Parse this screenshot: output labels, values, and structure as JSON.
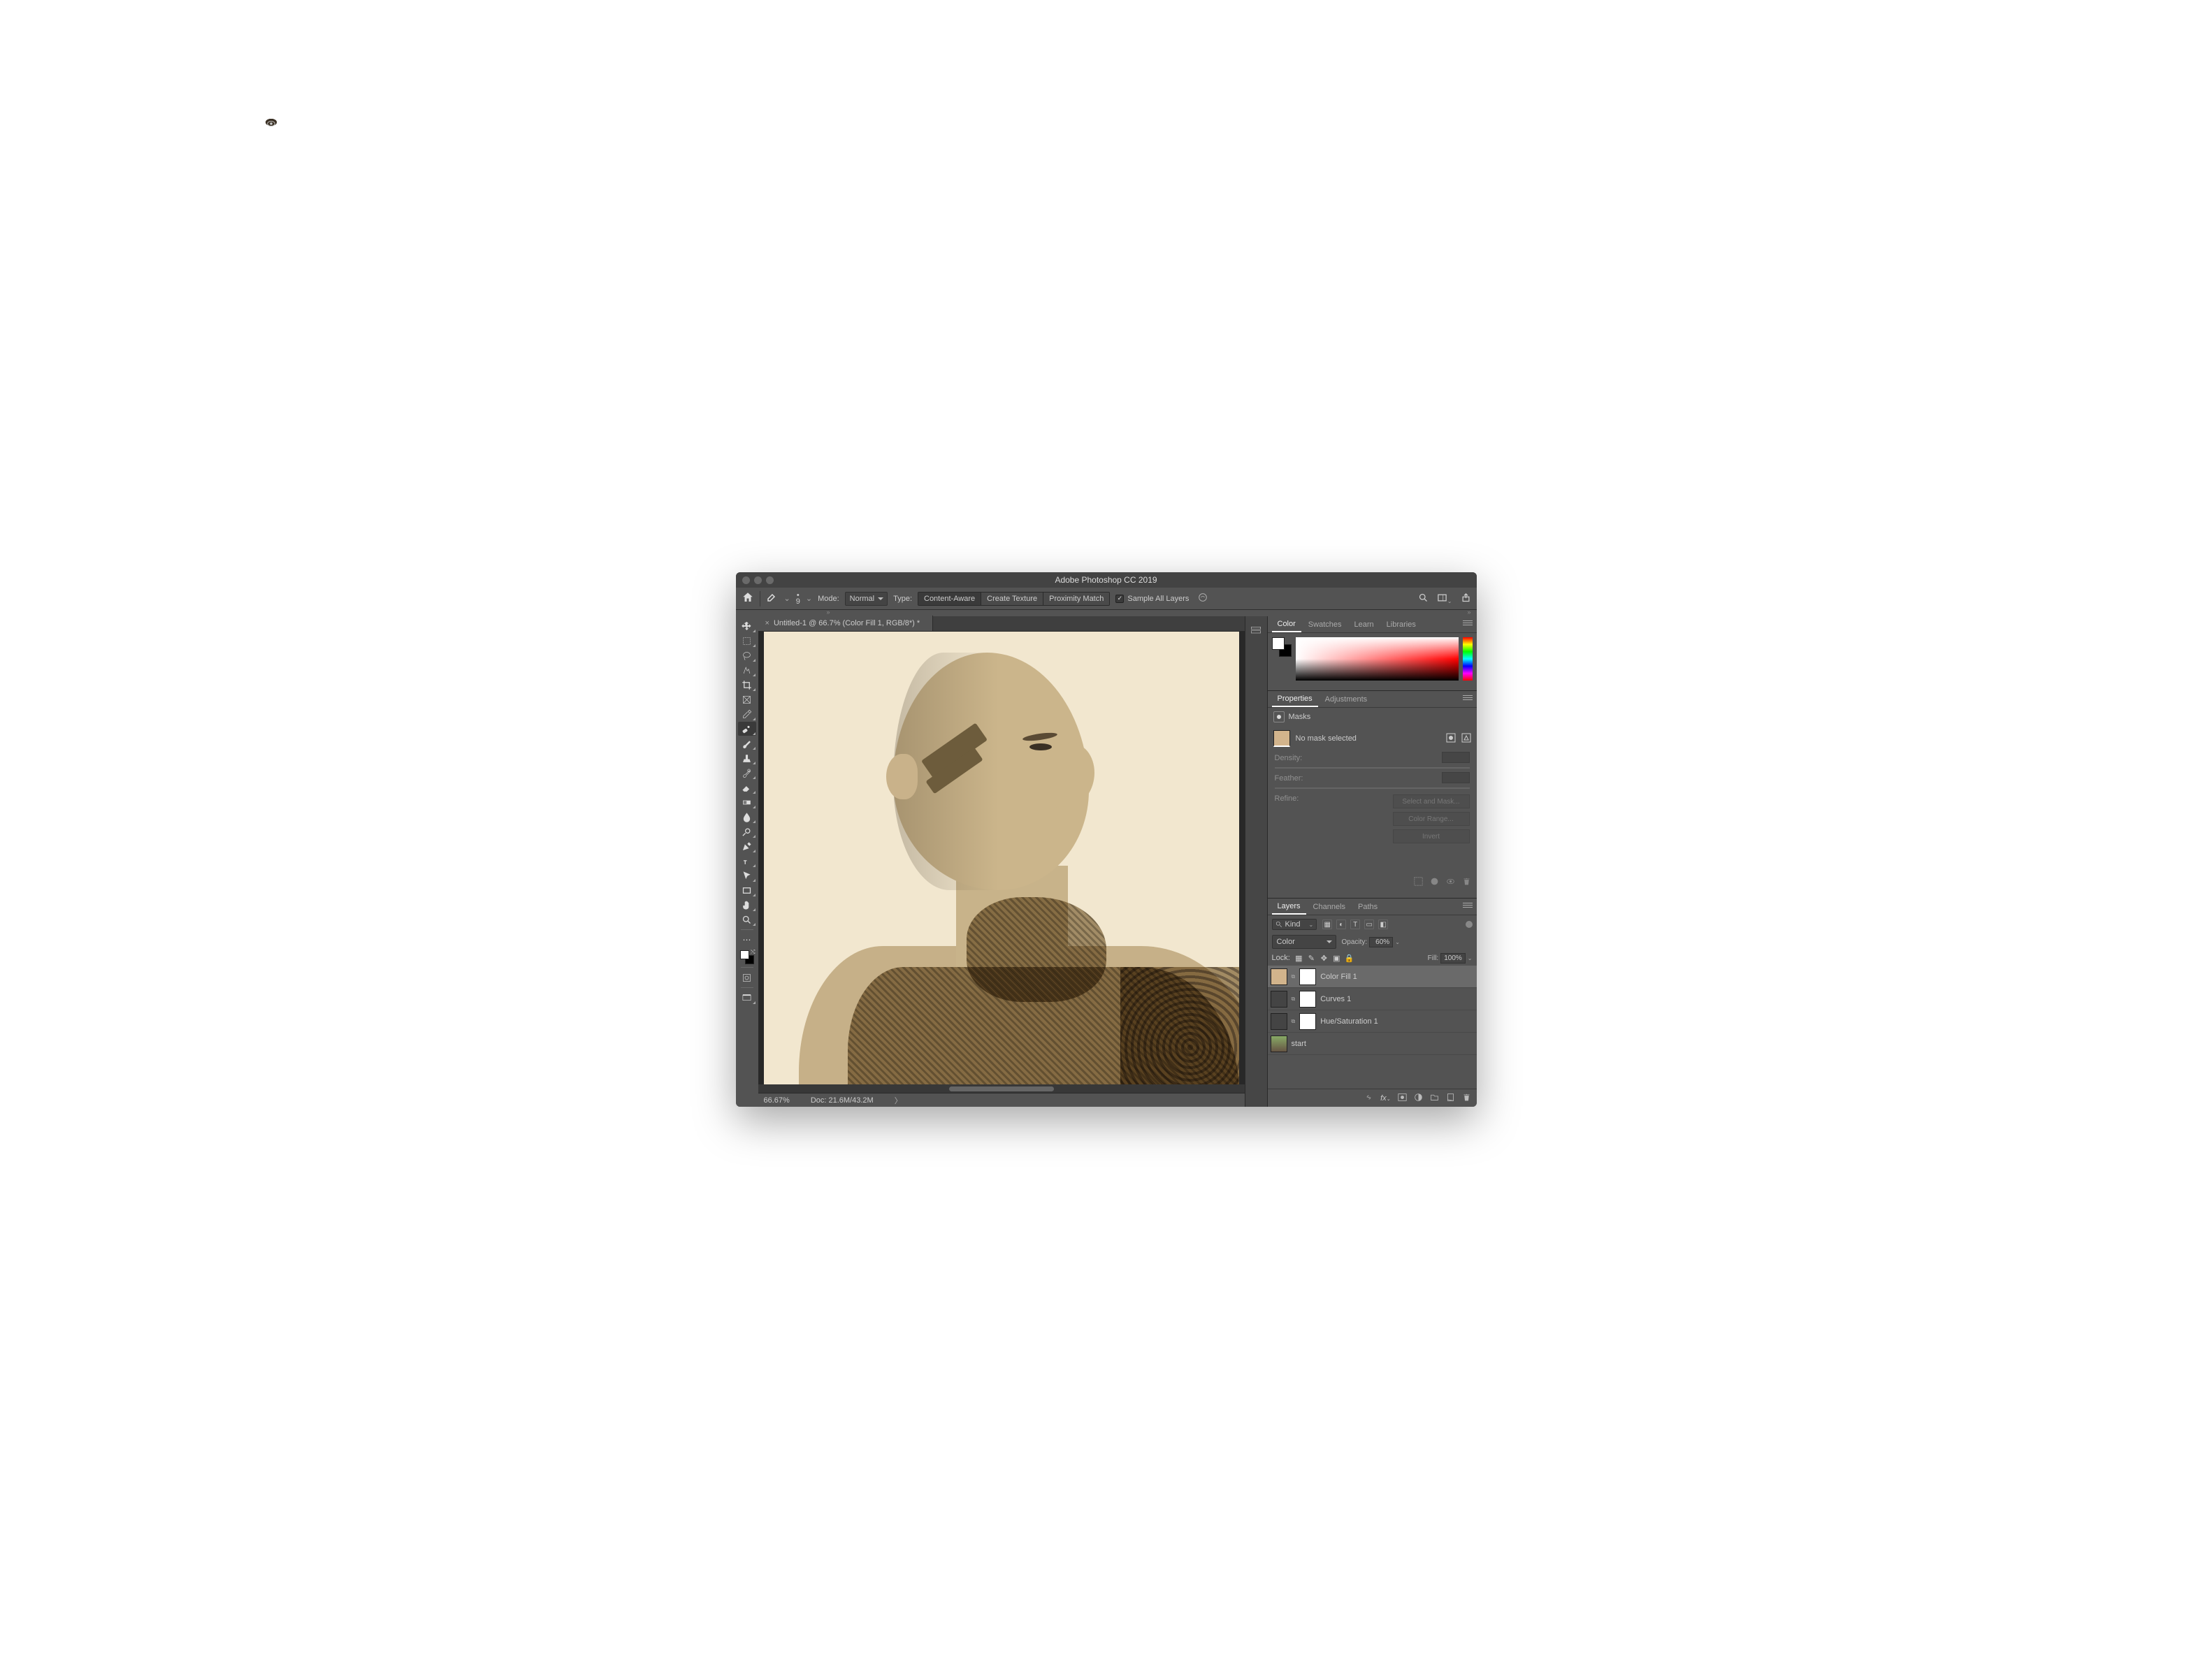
{
  "title": "Adobe Photoshop CC 2019",
  "optionsBar": {
    "brushSize": "9",
    "modeLabel": "Mode:",
    "modeValue": "Normal",
    "typeLabel": "Type:",
    "segments": [
      "Content-Aware",
      "Create Texture",
      "Proximity Match"
    ],
    "activeSegment": 0,
    "sampleAll": "Sample All Layers"
  },
  "documentTab": {
    "title": "Untitled-1 @ 66.7% (Color Fill 1, RGB/8*) *"
  },
  "statusBar": {
    "zoom": "66.67%",
    "docSize": "Doc: 21.6M/43.2M"
  },
  "colorPanel": {
    "tabs": [
      "Color",
      "Swatches",
      "Learn",
      "Libraries"
    ],
    "active": 0
  },
  "propertiesPanel": {
    "tabs": [
      "Properties",
      "Adjustments"
    ],
    "active": 0,
    "section": "Masks",
    "maskStatus": "No mask selected",
    "densityLabel": "Density:",
    "featherLabel": "Feather:",
    "refineLabel": "Refine:",
    "buttons": [
      "Select and Mask...",
      "Color Range...",
      "Invert"
    ]
  },
  "layersPanel": {
    "tabs": [
      "Layers",
      "Channels",
      "Paths"
    ],
    "active": 0,
    "searchKind": "Kind",
    "blendMode": "Color",
    "opacityLabel": "Opacity:",
    "opacityValue": "60%",
    "lockLabel": "Lock:",
    "fillLabel": "Fill:",
    "fillValue": "100%",
    "layers": [
      {
        "name": "Color Fill 1",
        "thumb": "fill",
        "hasMask": true,
        "selected": true
      },
      {
        "name": "Curves 1",
        "thumb": "curves",
        "hasMask": true,
        "selected": false
      },
      {
        "name": "Hue/Saturation 1",
        "thumb": "hue",
        "hasMask": true,
        "selected": false
      },
      {
        "name": "start",
        "thumb": "start",
        "hasMask": false,
        "selected": false
      }
    ]
  },
  "tools": [
    "move",
    "marquee",
    "lasso",
    "wand",
    "crop",
    "frame",
    "eyedropper",
    "healing",
    "brush",
    "stamp",
    "history",
    "eraser",
    "gradient",
    "blur",
    "dodge",
    "pen",
    "type",
    "path-select",
    "rectangle",
    "hand",
    "zoom"
  ]
}
